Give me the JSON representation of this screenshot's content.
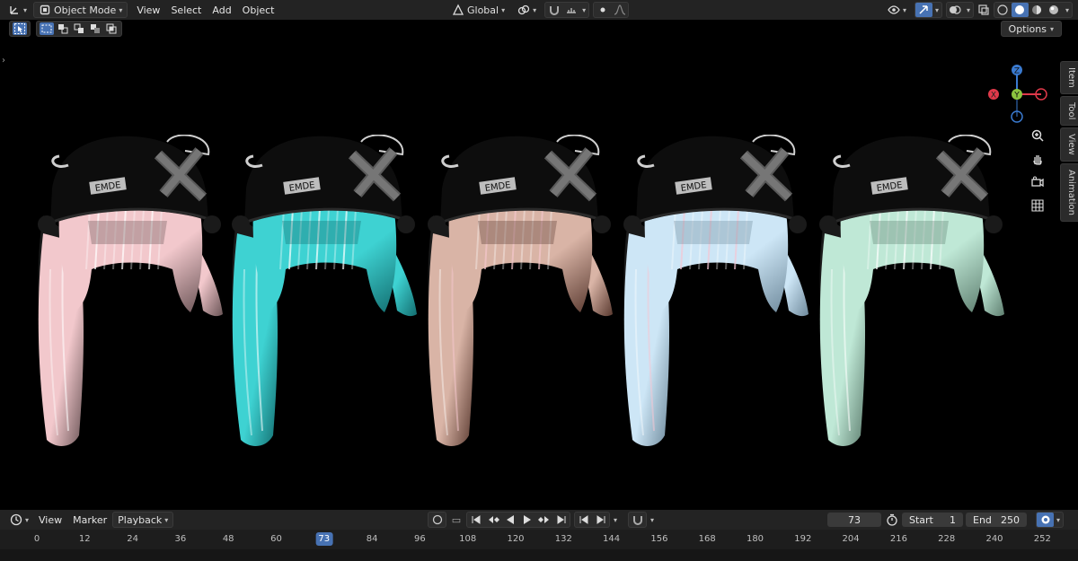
{
  "header": {
    "mode": "Object Mode",
    "menus": [
      "View",
      "Select",
      "Add",
      "Object"
    ],
    "transform_orientation": "Global"
  },
  "options_label": "Options",
  "sidebar_tabs": [
    "Item",
    "Tool",
    "View",
    "Animation"
  ],
  "gizmo": {
    "x": "X",
    "y": "Y",
    "z": "Z"
  },
  "models": [
    {
      "label": "EMDE",
      "hair_color": "#f2c8cc",
      "shadow_color": "#6b5557"
    },
    {
      "label": "EMDE",
      "hair_color": "#3ed2d2",
      "shadow_color": "#136e70"
    },
    {
      "label": "EMDE",
      "hair_color": "#d9b4a6",
      "shadow_color": "#5a3a30",
      "stripe_color": "#f4c6cc"
    },
    {
      "label": "EMDE",
      "hair_color": "#cde6f6",
      "shadow_color": "#6f8a9c",
      "stripe_color": "#f4c6d4"
    },
    {
      "label": "EMDE",
      "hair_color": "#bfe8d6",
      "shadow_color": "#5f7f70"
    }
  ],
  "timeline": {
    "menus": [
      "View",
      "Marker",
      "Playback"
    ],
    "current_frame": "73",
    "start_label": "Start",
    "start": "1",
    "end_label": "End",
    "end": "250",
    "ruler": [
      {
        "label": "0",
        "current": false
      },
      {
        "label": "12",
        "current": false
      },
      {
        "label": "24",
        "current": false
      },
      {
        "label": "36",
        "current": false
      },
      {
        "label": "48",
        "current": false
      },
      {
        "label": "60",
        "current": false
      },
      {
        "label": "73",
        "current": true
      },
      {
        "label": "84",
        "current": false
      },
      {
        "label": "96",
        "current": false
      },
      {
        "label": "108",
        "current": false
      },
      {
        "label": "120",
        "current": false
      },
      {
        "label": "132",
        "current": false
      },
      {
        "label": "144",
        "current": false
      },
      {
        "label": "156",
        "current": false
      },
      {
        "label": "168",
        "current": false
      },
      {
        "label": "180",
        "current": false
      },
      {
        "label": "192",
        "current": false
      },
      {
        "label": "204",
        "current": false
      },
      {
        "label": "216",
        "current": false
      },
      {
        "label": "228",
        "current": false
      },
      {
        "label": "240",
        "current": false
      },
      {
        "label": "252",
        "current": false
      }
    ]
  },
  "colors": {
    "accent": "#4772b3",
    "axis_x": "#e0394a",
    "axis_y": "#8cc63f",
    "axis_z": "#3a7ad0"
  }
}
